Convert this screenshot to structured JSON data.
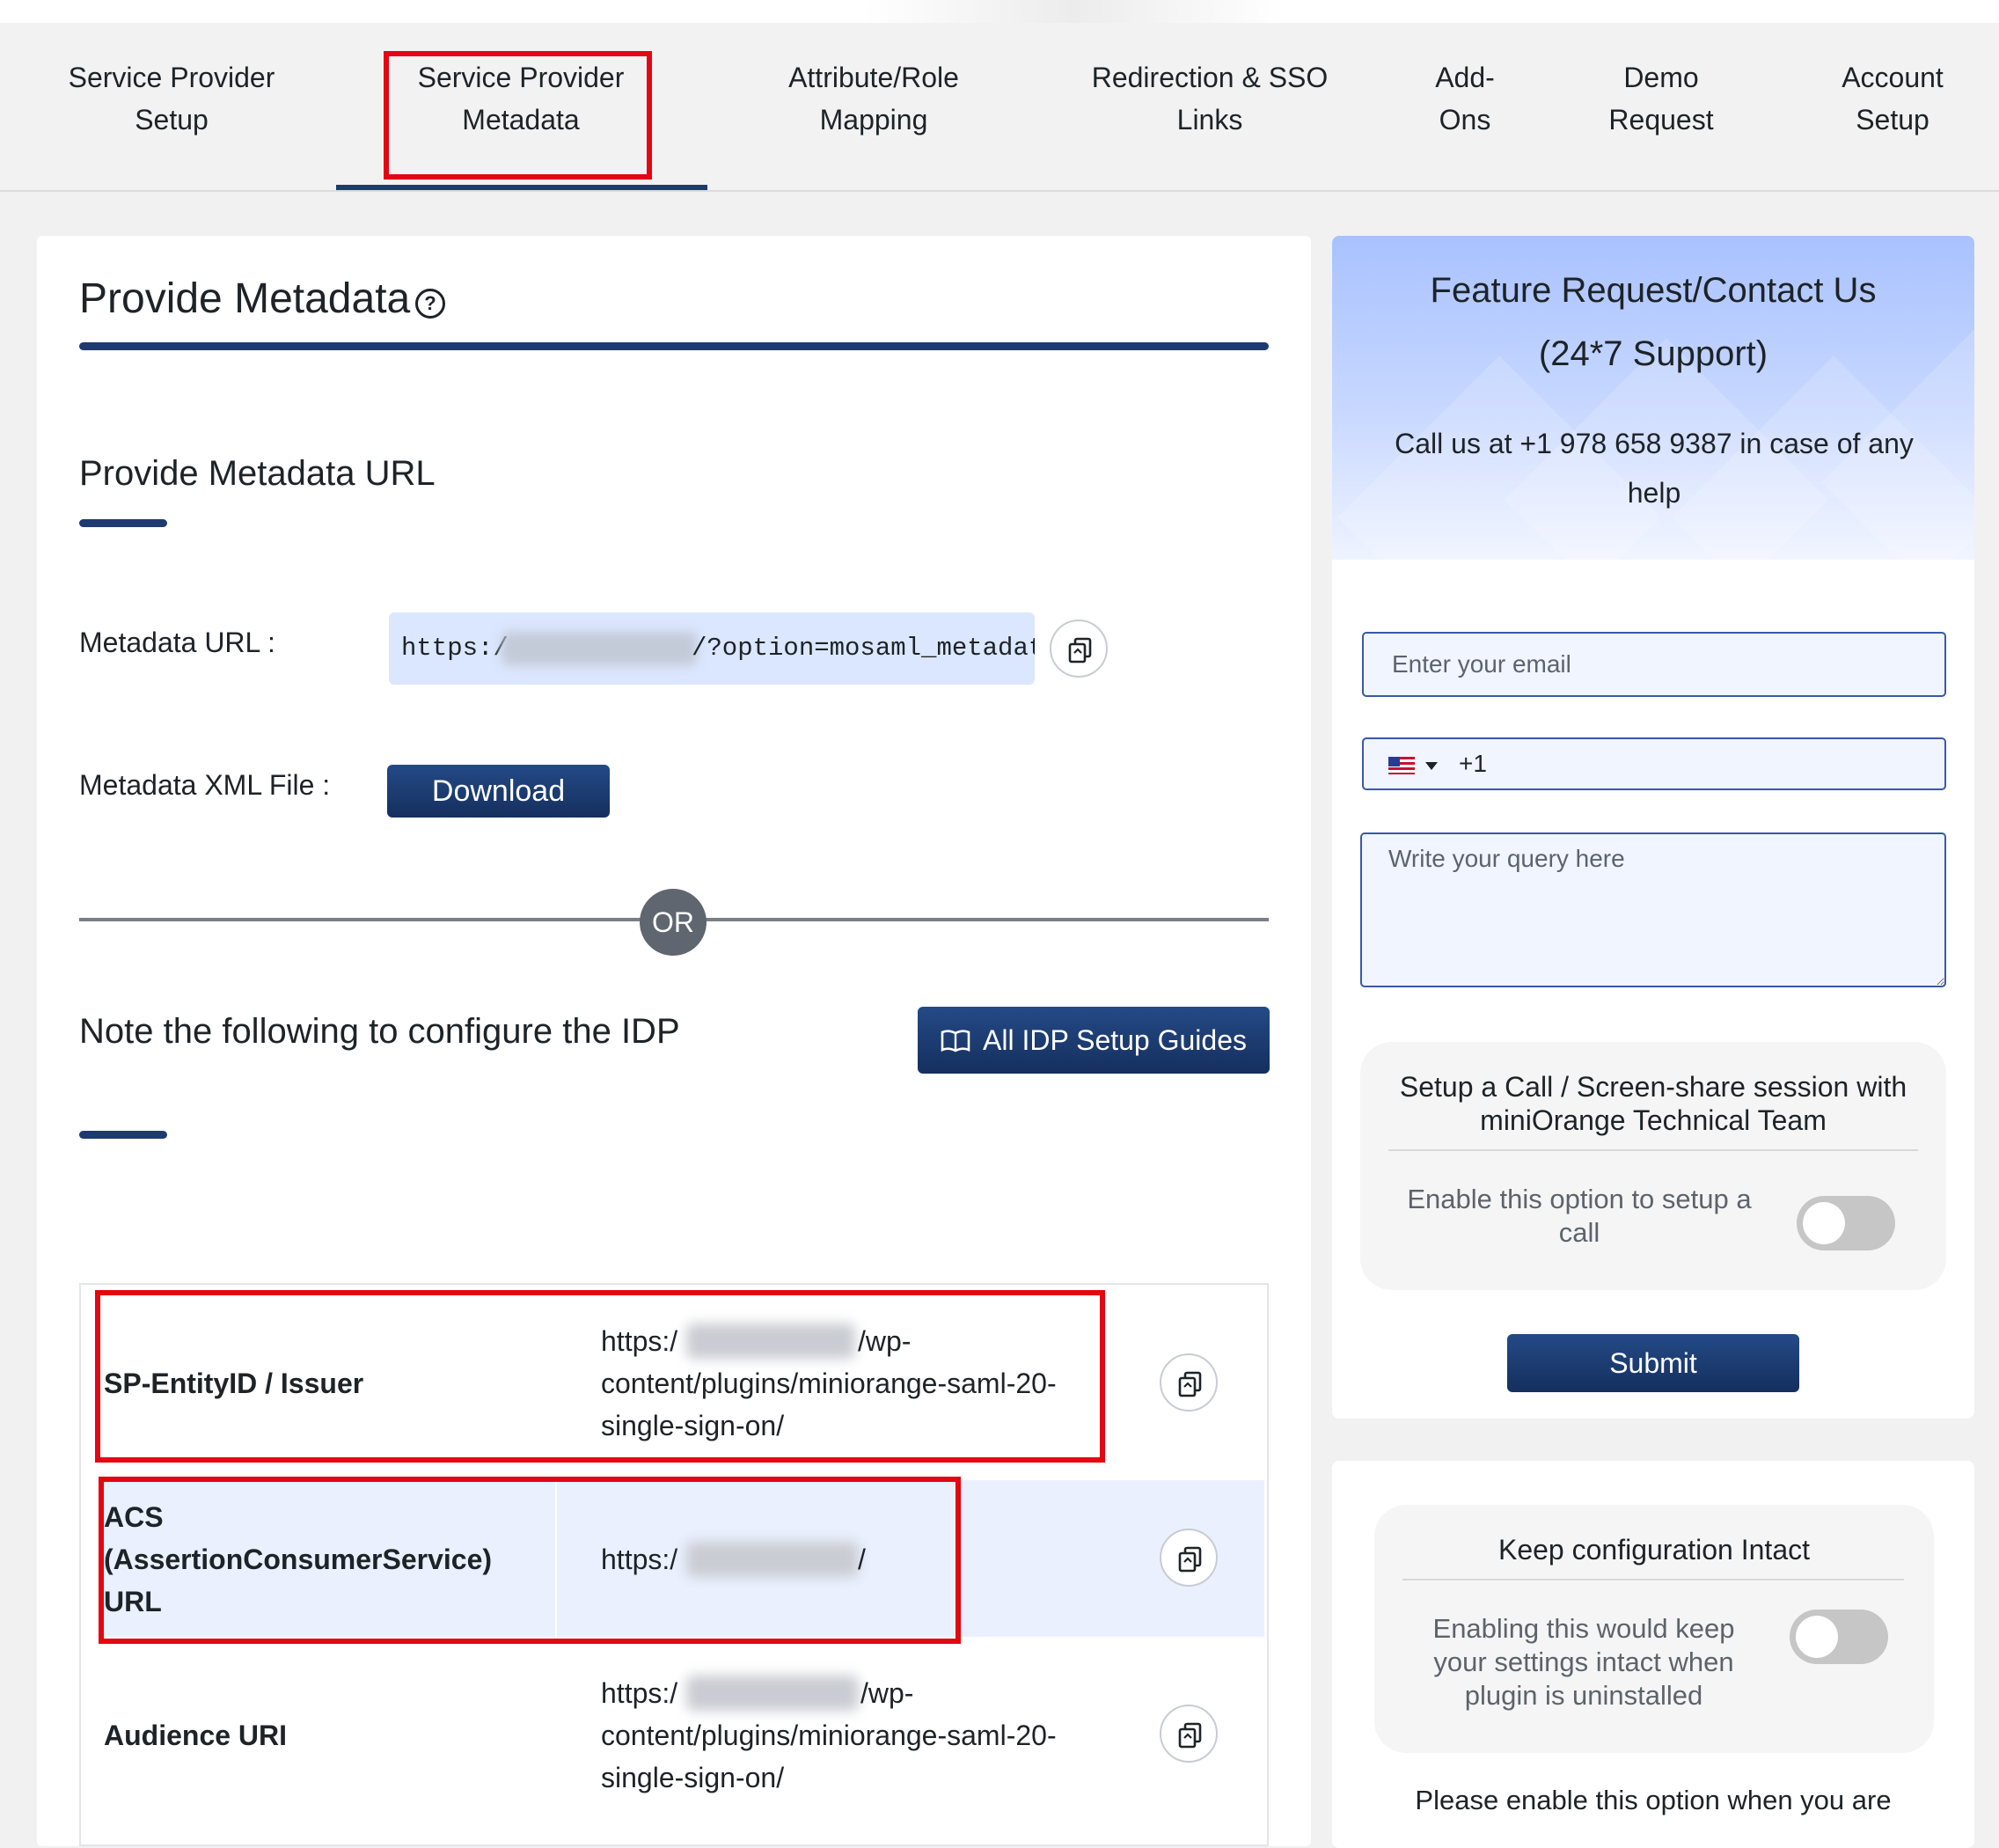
{
  "tabs": [
    {
      "label_line1": "Service Provider",
      "label_line2": "Setup"
    },
    {
      "label_line1": "Service Provider",
      "label_line2": "Metadata"
    },
    {
      "label_line1": "Attribute/Role",
      "label_line2": "Mapping"
    },
    {
      "label_line1": "Redirection & SSO",
      "label_line2": "Links"
    },
    {
      "label_line1": "Add-",
      "label_line2": "Ons"
    },
    {
      "label_line1": "Demo",
      "label_line2": "Request"
    },
    {
      "label_line1": "Account",
      "label_line2": "Setup"
    }
  ],
  "main": {
    "title": "Provide Metadata",
    "help_icon": "?",
    "metadata_url_heading": "Provide Metadata URL",
    "metadata_url_label": "Metadata URL :",
    "metadata_url_prefix": "https:/",
    "metadata_url_suffix": "/?option=mosaml_metadata",
    "metadata_xml_label": "Metadata XML File :",
    "download_label": "Download",
    "or_label": "OR",
    "note_heading": "Note the following to configure the IDP",
    "guides_button": "All IDP Setup Guides",
    "table": [
      {
        "key": "SP-EntityID / Issuer",
        "value_line1_prefix": "https:/",
        "value_line1_suffix": "/wp-",
        "value_line2": "content/plugins/miniorange-saml-20-",
        "value_line3": "single-sign-on/"
      },
      {
        "key_line1": "ACS",
        "key_line2": "(AssertionConsumerService)",
        "key_line3": "URL",
        "value_prefix": "https:/",
        "value_suffix": "/"
      },
      {
        "key": "Audience URI",
        "value_line1_prefix": "https:/",
        "value_line1_suffix": "/wp-",
        "value_line2": "content/plugins/miniorange-saml-20-",
        "value_line3": "single-sign-on/"
      }
    ]
  },
  "sidebar": {
    "title_line1": "Feature Request/Contact Us",
    "title_line2": "(24*7 Support)",
    "call_text": "Call us at +1 978 658 9387 in case of any help",
    "email_placeholder": "Enter your email",
    "phone_code": "+1",
    "query_placeholder": "Write your query here",
    "call_panel": {
      "title": "Setup a Call / Screen-share session with miniOrange Technical Team",
      "toggle_text": "Enable this option to setup a call",
      "toggle_on": false
    },
    "submit_label": "Submit",
    "config_panel": {
      "title": "Keep configuration Intact",
      "toggle_text": "Enabling this would keep your settings intact when plugin is uninstalled",
      "toggle_on": false
    },
    "bottom_note": "Please enable this option when you are"
  },
  "colors": {
    "accent": "#1e3b70",
    "highlight": "#e30613",
    "input_bg": "#f1f5ff",
    "url_bg": "#dbe7fe"
  },
  "icons": [
    "help-icon",
    "copy-icon",
    "book-icon",
    "us-flag-icon",
    "caret-down-icon"
  ]
}
